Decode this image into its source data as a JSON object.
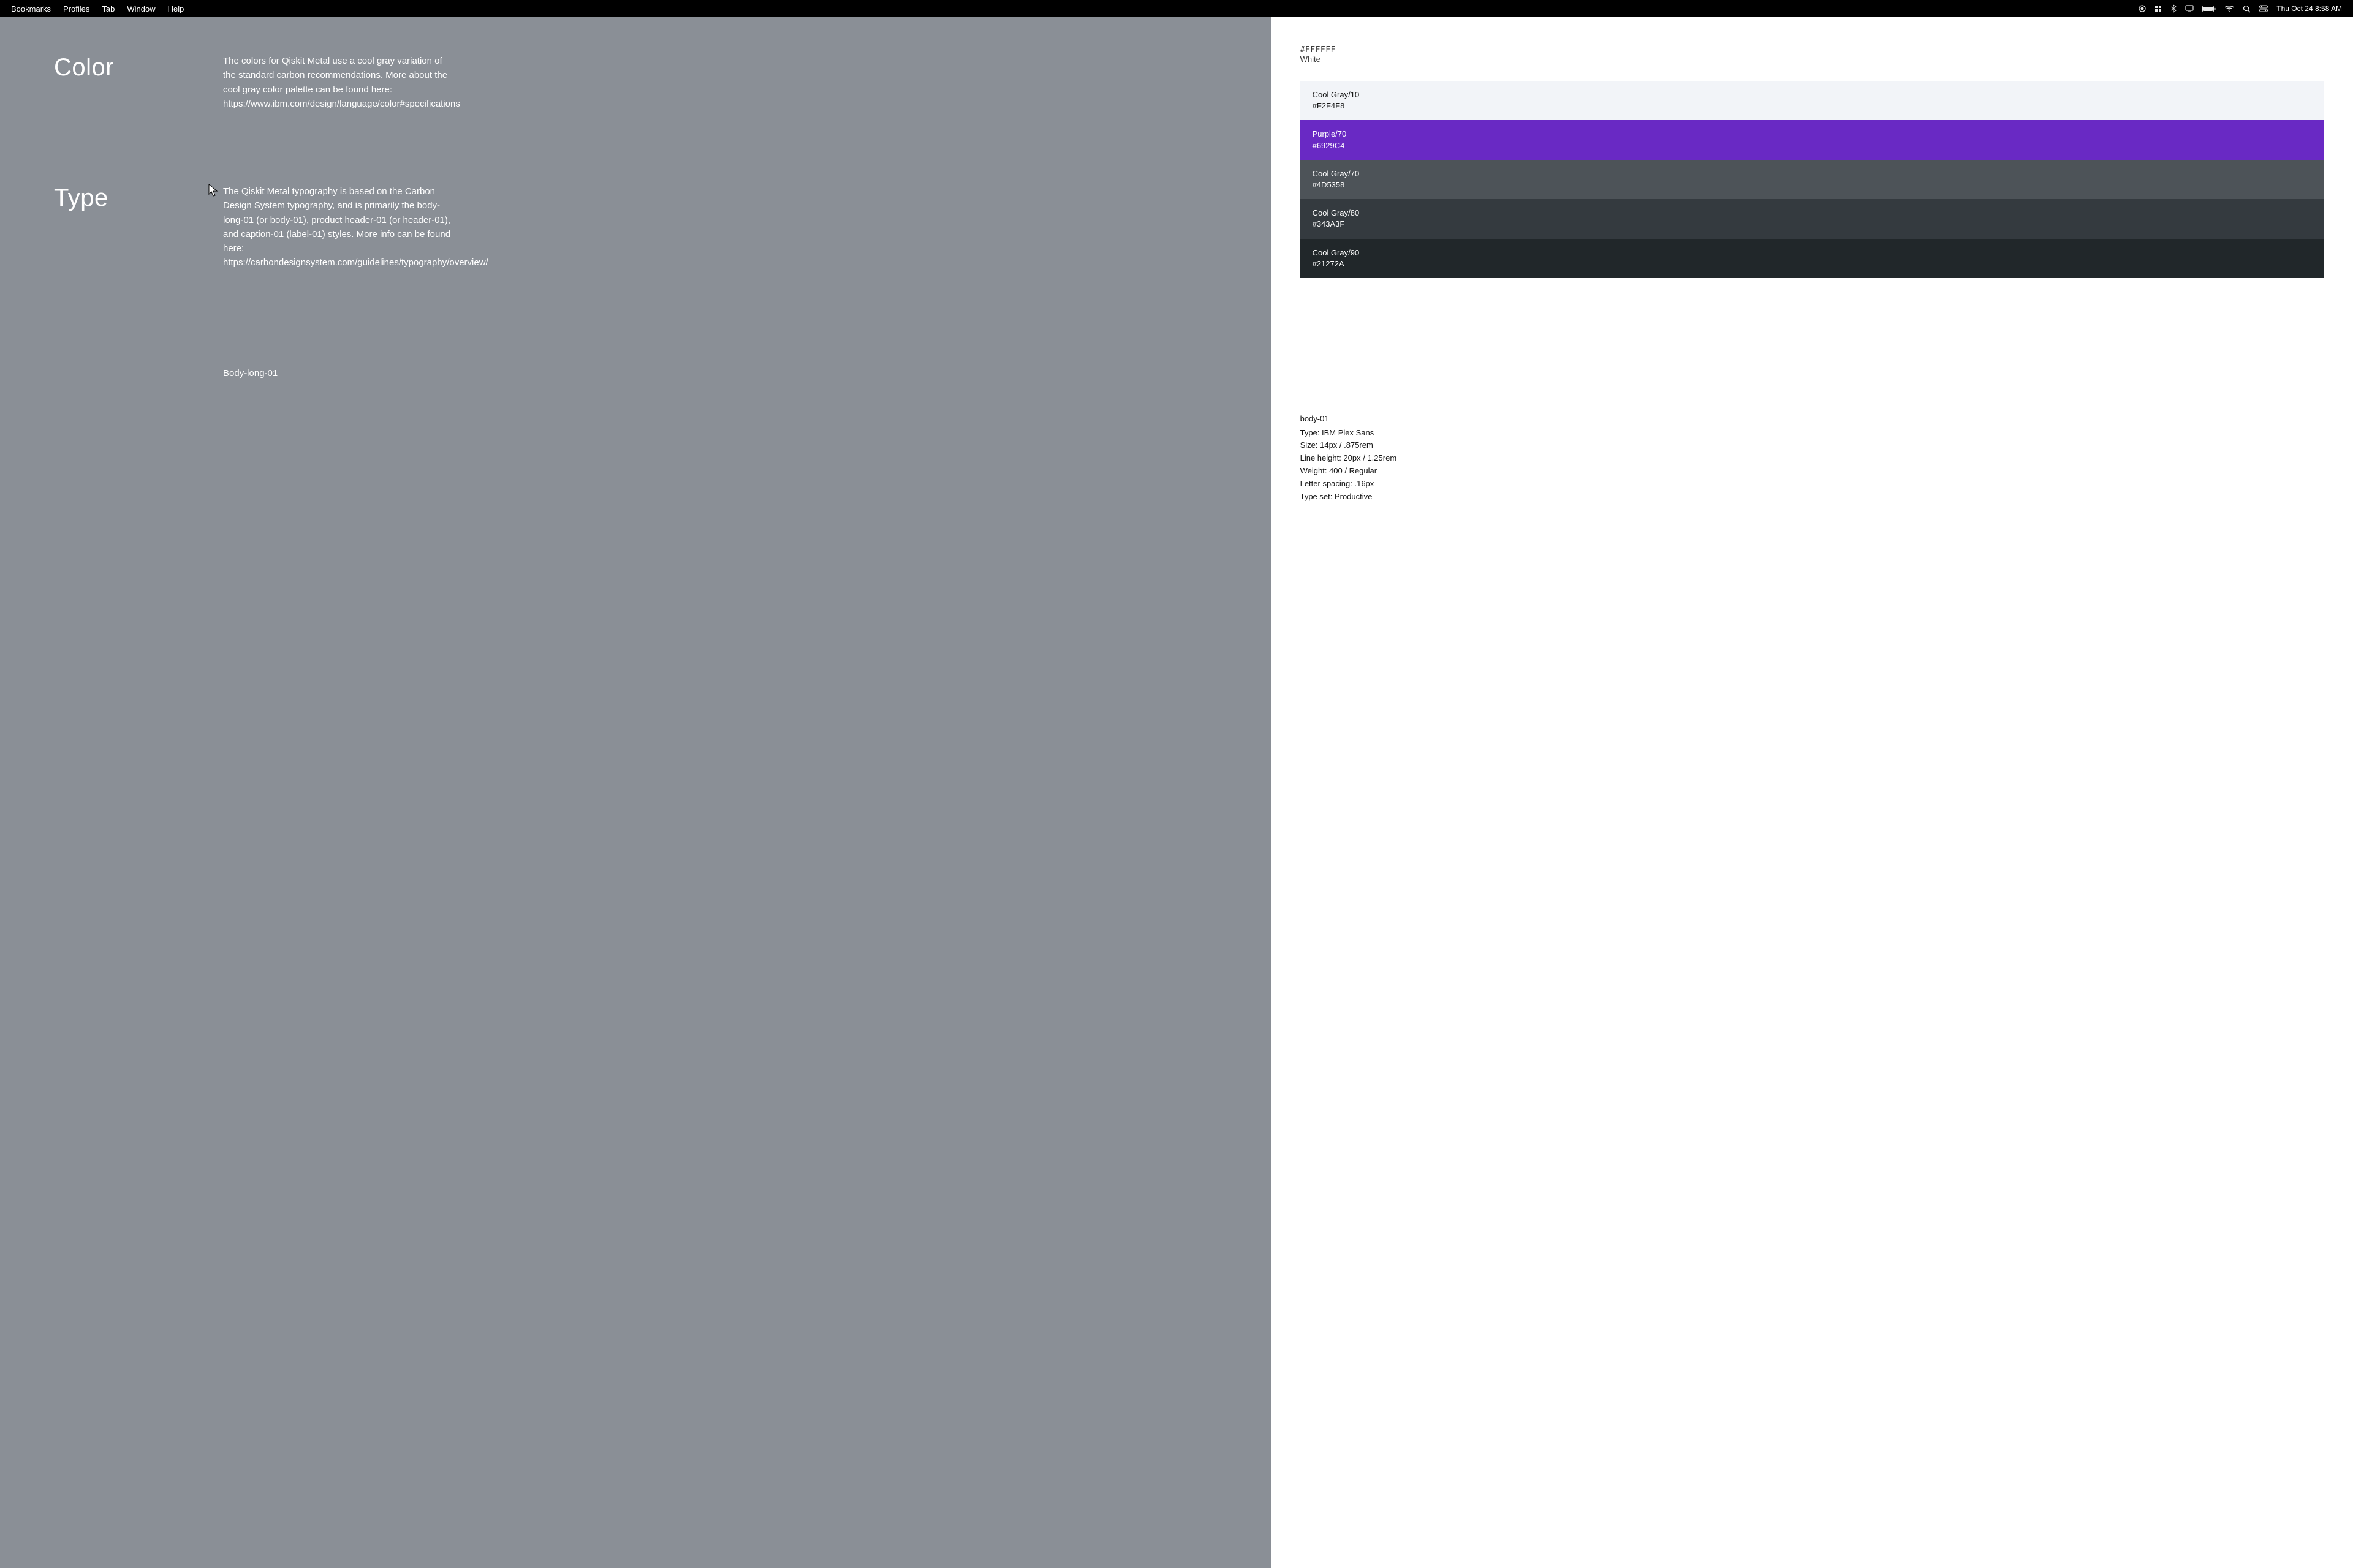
{
  "menubar": {
    "items": [
      "Bookmarks",
      "Profiles",
      "Tab",
      "Window",
      "Help"
    ],
    "clock": "Thu Oct 24  8:58 AM"
  },
  "color_section": {
    "title": "Color",
    "description": "The colors for Qiskit Metal use a cool gray variation of the standard carbon recommendations. More about the cool gray color palette can be found here: https://www.ibm.com/design/language/color#specifications"
  },
  "swatch_intro": {
    "hex": "#FFFFFF",
    "name": "White"
  },
  "swatches": [
    {
      "name": "Cool Gray/10",
      "hex": "#F2F4F8",
      "bg": "#F2F4F8",
      "tone": "light"
    },
    {
      "name": "Purple/70",
      "hex": "#6929C4",
      "bg": "#6929C4",
      "tone": "dark"
    },
    {
      "name": "Cool Gray/70",
      "hex": "#4D5358",
      "bg": "#4D5358",
      "tone": "dark"
    },
    {
      "name": "Cool Gray/80",
      "hex": "#343A3F",
      "bg": "#343A3F",
      "tone": "dark"
    },
    {
      "name": "Cool Gray/90",
      "hex": "#21272A",
      "bg": "#21272A",
      "tone": "dark"
    }
  ],
  "type_section": {
    "title": "Type",
    "description": "The Qiskit Metal typography is based on the Carbon Design System typography, and is primarily the body-long-01 (or body-01), product header-01 (or header-01), and caption-01 (label-01) styles. More info can be found here: https://carbondesignsystem.com/guidelines/typography/overview/",
    "subhead": "Body-long-01"
  },
  "type_spec": {
    "name": "body-01",
    "lines": [
      "Type: IBM Plex Sans",
      "Size: 14px / .875rem",
      "Line height: 20px / 1.25rem",
      "Weight: 400 / Regular",
      "Letter spacing: .16px",
      "Type set: Productive"
    ]
  }
}
